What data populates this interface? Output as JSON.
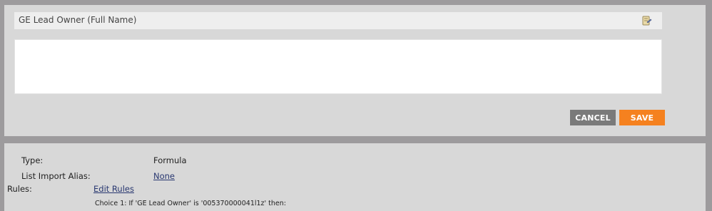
{
  "editor": {
    "field_name": "GE Lead Owner (Full Name)",
    "description": "",
    "cancel_label": "CANCEL",
    "save_label": "SAVE"
  },
  "details": {
    "type_label": "Type:",
    "type_value": "Formula",
    "alias_label": "List Import Alias:",
    "alias_value": "None",
    "rules_label": "Rules:",
    "rules_link": "Edit Rules",
    "choice_text": "Choice 1: If 'GE Lead Owner' is '005370000041l1z' then:"
  },
  "colors": {
    "save_button": "#f5811f",
    "cancel_button": "#7a7a7a",
    "link": "#283770"
  }
}
